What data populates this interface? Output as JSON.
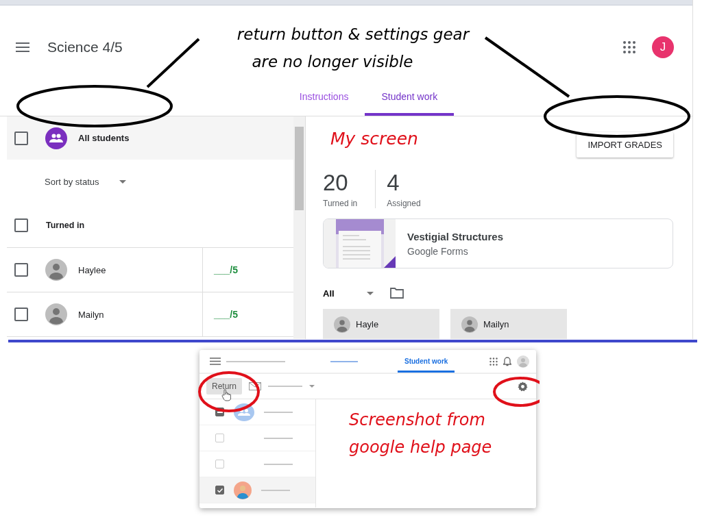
{
  "callout": {
    "lines": [
      "return button & settings gear",
      "are no longer visible"
    ]
  },
  "screen_label": "My screen",
  "app": {
    "title": "Science 4/5",
    "avatar_letter": "J",
    "tabs": [
      {
        "label": "Instructions",
        "selected": false
      },
      {
        "label": "Student work",
        "selected": true
      }
    ],
    "all_students": {
      "label": "All students",
      "checked": false
    },
    "sort": "Sort by status",
    "group": {
      "label": "Turned in",
      "checked": false
    },
    "students": [
      {
        "name": "Haylee",
        "grade": "___/5",
        "checked": false
      },
      {
        "name": "Mailyn",
        "grade": "___/5",
        "checked": false
      }
    ],
    "import_button": "IMPORT GRADES",
    "stats": [
      {
        "value": "20",
        "label": "Turned in"
      },
      {
        "value": "4",
        "label": "Assigned"
      }
    ],
    "attachment": {
      "title": "Vestigial Structures",
      "subtitle": "Google Forms"
    },
    "filter": "All",
    "cards": [
      "Hayle",
      "Mailyn"
    ]
  },
  "help": {
    "label_lines": [
      "Screenshot from",
      "google help page"
    ],
    "tab": {
      "label": "Student work",
      "selected": true
    },
    "return_button": "Return",
    "rows": [
      {
        "kind": "group",
        "indeterminate": true
      },
      {
        "kind": "blank",
        "checked": false
      },
      {
        "kind": "blank",
        "checked": false
      },
      {
        "kind": "student",
        "checked": true
      }
    ]
  }
}
